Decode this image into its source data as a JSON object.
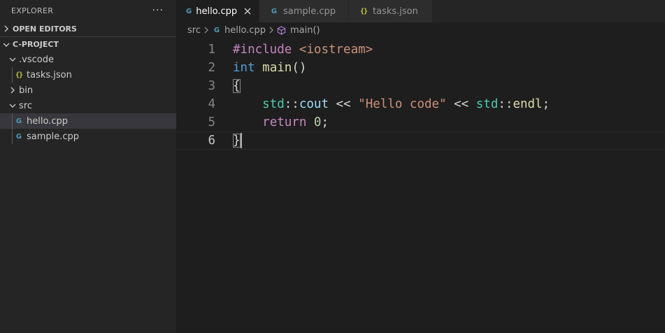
{
  "sidebar": {
    "title": "EXPLORER",
    "more": "···",
    "open_editors": "OPEN EDITORS",
    "project": "C-PROJECT",
    "tree": {
      "vscode": ".vscode",
      "tasks": "tasks.json",
      "bin": "bin",
      "src": "src",
      "hello": "hello.cpp",
      "sample": "sample.cpp"
    }
  },
  "tabs": [
    {
      "label": "hello.cpp",
      "active": true
    },
    {
      "label": "sample.cpp",
      "active": false
    },
    {
      "label": "tasks.json",
      "active": false
    }
  ],
  "breadcrumb": {
    "folder": "src",
    "file": "hello.cpp",
    "symbol": "main()"
  },
  "icons": {
    "json": "{}",
    "cpp": "G"
  },
  "code": {
    "line_numbers": [
      "1",
      "2",
      "3",
      "4",
      "5",
      "6"
    ],
    "l1_pre": "#include",
    "l1_hdr": "<iostream>",
    "l2_type": "int",
    "l2_fn": "main",
    "l2_paren": "()",
    "l3_brace": "{",
    "l4_indent": "    ",
    "l4_std1": "std",
    "l4_sep1": "::",
    "l4_cout": "cout",
    "l4_op1": " << ",
    "l4_str": "\"Hello code\"",
    "l4_op2": " << ",
    "l4_std2": "std",
    "l4_sep2": "::",
    "l4_endl": "endl",
    "l4_semi": ";",
    "l5_indent": "    ",
    "l5_ret": "return",
    "l5_num": " 0",
    "l5_semi": ";",
    "l6_brace": "}"
  },
  "colors": {
    "background": "#1e1e1e",
    "sidebar": "#252526",
    "selected_row": "#37373d",
    "keyword": "#569cd6",
    "function": "#dcdcaa",
    "string": "#ce9178",
    "namespace": "#4ec9b0"
  }
}
